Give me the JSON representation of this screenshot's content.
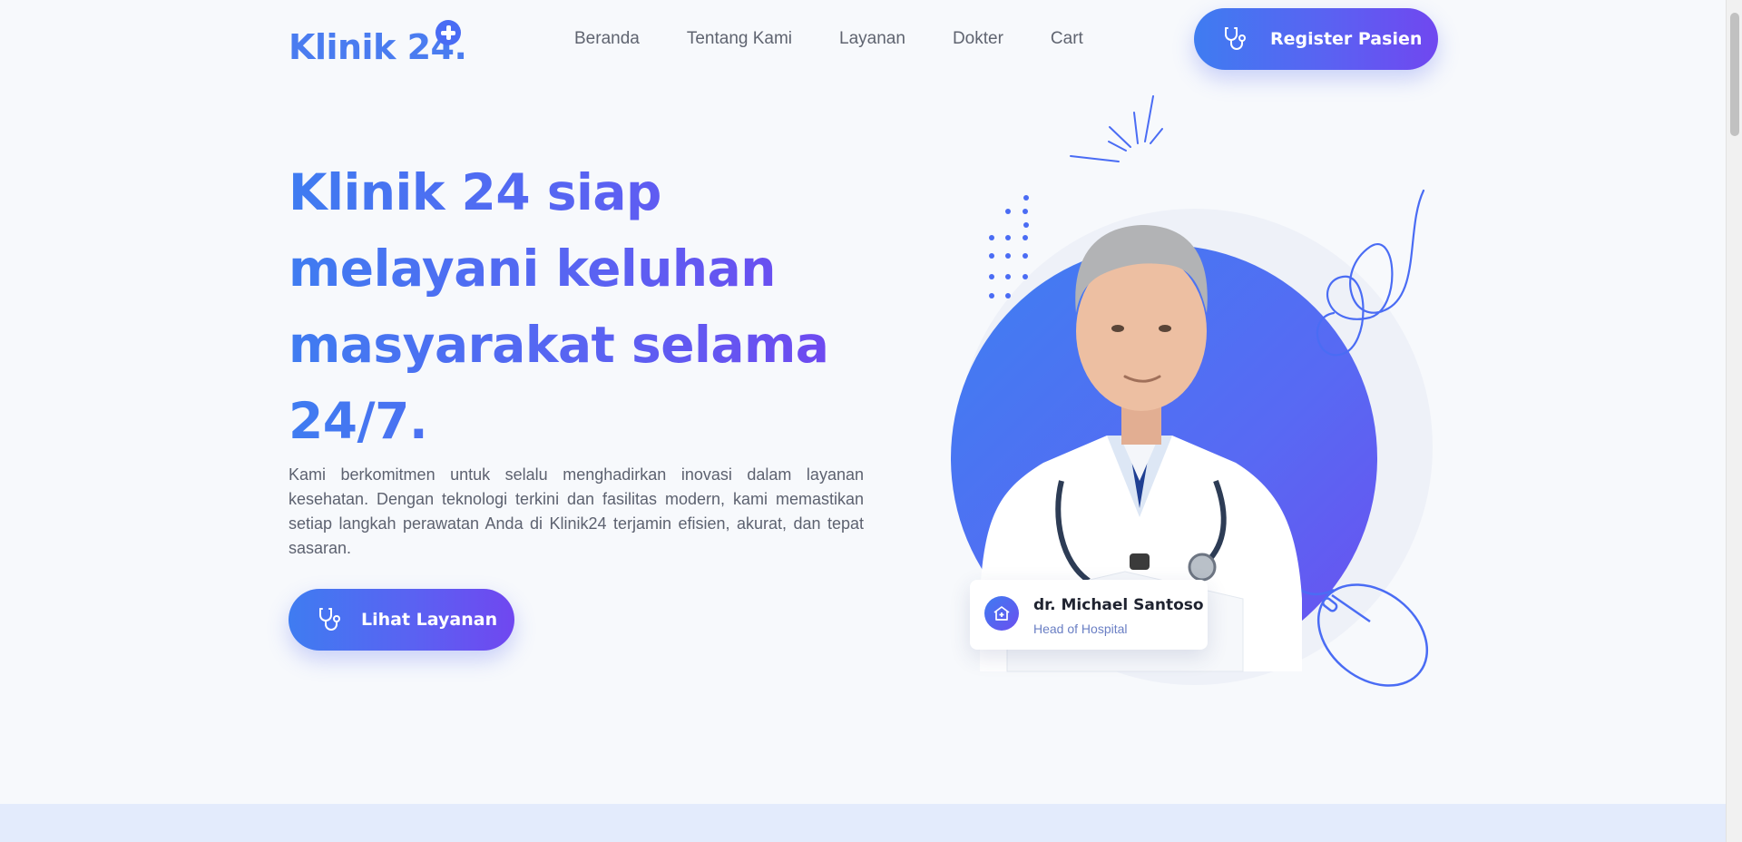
{
  "brand": {
    "logo_text": "Klinik 24.",
    "logo_badge_icon": "plus-icon",
    "accent_start": "#3f7cf1",
    "accent_end": "#7047f0"
  },
  "nav": {
    "items": [
      {
        "label": "Beranda"
      },
      {
        "label": "Tentang Kami"
      },
      {
        "label": "Layanan"
      },
      {
        "label": "Dokter"
      },
      {
        "label": "Cart"
      }
    ]
  },
  "header": {
    "register_label": "Register Pasien",
    "register_icon": "stethoscope-icon"
  },
  "hero": {
    "title": "Klinik 24 siap melayani keluhan masyarakat selama 24/7.",
    "description": "Kami berkomitmen untuk selalu menghadirkan inovasi dalam layanan kesehatan. Dengan teknologi terkini dan fasilitas modern, kami memastikan setiap langkah perawatan Anda di Klinik24 terjamin efisien, akurat, dan tepat sasaran.",
    "cta_label": "Lihat Layanan",
    "cta_icon": "stethoscope-icon"
  },
  "doctor_card": {
    "name": "dr. Michael Santoso",
    "role": "Head of Hospital",
    "icon": "hospital-icon"
  }
}
